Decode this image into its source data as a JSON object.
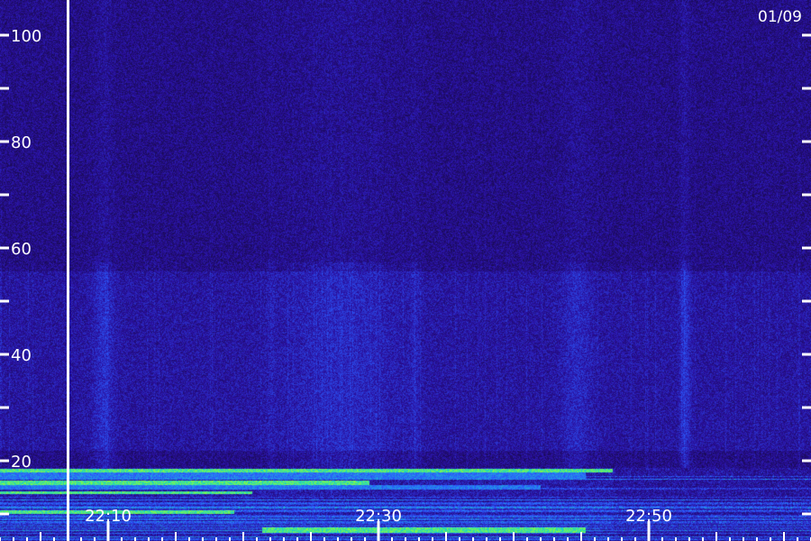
{
  "chart_data": {
    "type": "heatmap",
    "title": "",
    "xlabel": "",
    "ylabel": "",
    "date_label": "01/09",
    "y_ticks_labeled": [
      20,
      40,
      60,
      80,
      100
    ],
    "y_ticks_minor": [
      10,
      30,
      50,
      70,
      90
    ],
    "ylim": [
      0,
      110
    ],
    "x_ticks_labeled": [
      "22:10",
      "22:30",
      "22:50"
    ],
    "xlim": [
      "22:02",
      "22:62"
    ],
    "x_minor_tick_minutes": [
      5,
      10,
      15,
      20,
      25,
      30,
      35,
      40,
      45,
      50,
      55
    ],
    "gap_marker": "22:07",
    "colormap": [
      "#120830",
      "#2a10a0",
      "#2b5cff",
      "#19d3c8",
      "#8cff3a"
    ],
    "grid": false,
    "legend": "none"
  }
}
